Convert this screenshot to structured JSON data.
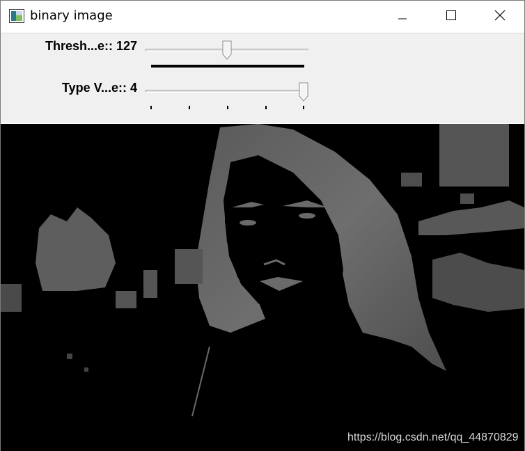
{
  "window": {
    "title": "binary image",
    "icon": "opencv-window-icon",
    "controls": [
      "minimize-icon",
      "maximize-icon",
      "close-icon"
    ]
  },
  "trackbars": [
    {
      "label": "Thresh...e:: 127",
      "value": 127,
      "max": 255
    },
    {
      "label": "Type V...e:: 4",
      "value": 4,
      "max": 4
    }
  ],
  "image": {
    "description_colors": {
      "background": "#000000",
      "foreground": "#6e6e6e"
    },
    "watermark": "https://blog.csdn.net/qq_44870829"
  }
}
